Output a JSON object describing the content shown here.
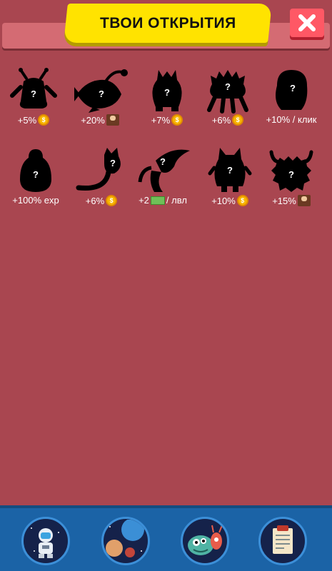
{
  "header": {
    "title": "ТВОИ ОТКРЫТИЯ",
    "close_icon": "close-icon"
  },
  "discoveries": [
    {
      "shape": "antenna-creature",
      "bonus": "+5%",
      "icon": "coin-icon"
    },
    {
      "shape": "anglerfish",
      "bonus": "+20%",
      "icon": "worker-icon"
    },
    {
      "shape": "twin-eared-blob",
      "bonus": "+7%",
      "icon": "coin-icon"
    },
    {
      "shape": "spiky-walker",
      "bonus": "+6%",
      "icon": "coin-icon"
    },
    {
      "shape": "round-blob",
      "bonus": "+10% / клик",
      "icon": ""
    },
    {
      "shape": "penguin-blob",
      "bonus": "+100% exp",
      "icon": ""
    },
    {
      "shape": "cat-tail",
      "bonus": "+6%",
      "icon": "coin-icon"
    },
    {
      "shape": "winged-beast",
      "bonus": "+2",
      "icon": "cash-icon",
      "suffix": "/ лвл"
    },
    {
      "shape": "horned-owl",
      "bonus": "+10%",
      "icon": "coin-icon"
    },
    {
      "shape": "furry-horned",
      "bonus": "+15%",
      "icon": "worker-icon"
    }
  ],
  "bottom_nav": [
    {
      "name": "astronaut-nav-icon"
    },
    {
      "name": "planets-nav-icon"
    },
    {
      "name": "aliens-nav-icon"
    },
    {
      "name": "notes-nav-icon"
    }
  ],
  "colors": {
    "background": "#a94650",
    "title_badge": "#ffe300",
    "close_button": "#ff5865",
    "bottom_bar": "#1b63a6"
  }
}
